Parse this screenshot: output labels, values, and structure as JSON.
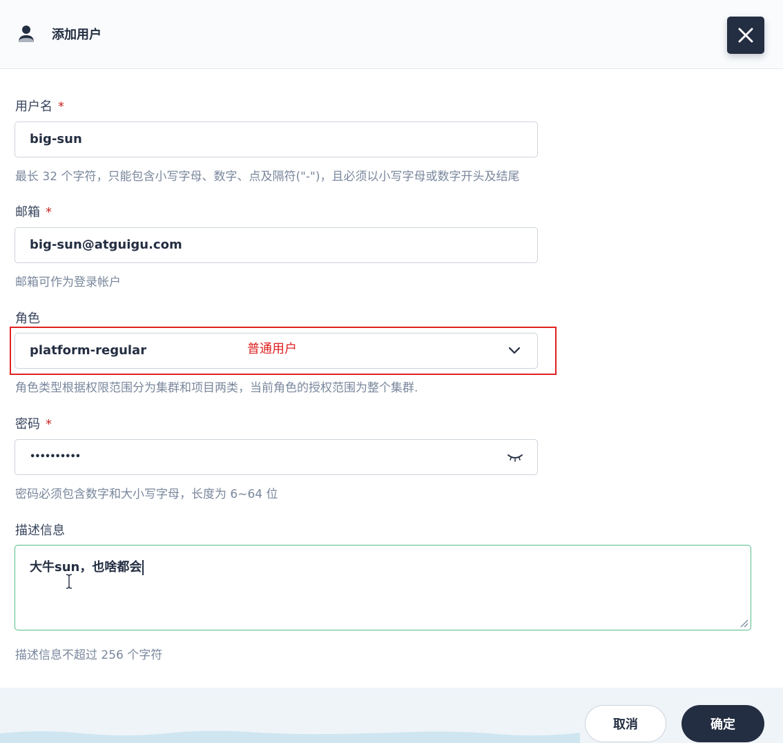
{
  "header": {
    "title": "添加用户",
    "icon": "user-icon"
  },
  "form": {
    "username": {
      "label": "用户名",
      "required_mark": "*",
      "value": "big-sun",
      "hint": "最长 32 个字符，只能包含小写字母、数字、点及隔符(\"-\")，且必须以小写字母或数字开头及结尾"
    },
    "email": {
      "label": "邮箱",
      "required_mark": "*",
      "value": "big-sun@atguigu.com",
      "hint": "邮箱可作为登录帐户"
    },
    "role": {
      "label": "角色",
      "value": "platform-regular",
      "annotation": "普通用户",
      "hint": "角色类型根据权限范围分为集群和项目两类，当前角色的授权范围为整个集群."
    },
    "password": {
      "label": "密码",
      "required_mark": "*",
      "value": "••••••••••",
      "hint": "密码必须包含数字和大小写字母，长度为 6~64 位"
    },
    "description": {
      "label": "描述信息",
      "value": "大牛sun，也啥都会",
      "hint": "描述信息不超过 256 个字符"
    }
  },
  "footer": {
    "cancel_label": "取消",
    "ok_label": "确定"
  },
  "colors": {
    "dark": "#242e42",
    "required": "#ca2621",
    "annotation": "#e02020",
    "focus": "#55bc8a",
    "hint": "#79879c"
  }
}
